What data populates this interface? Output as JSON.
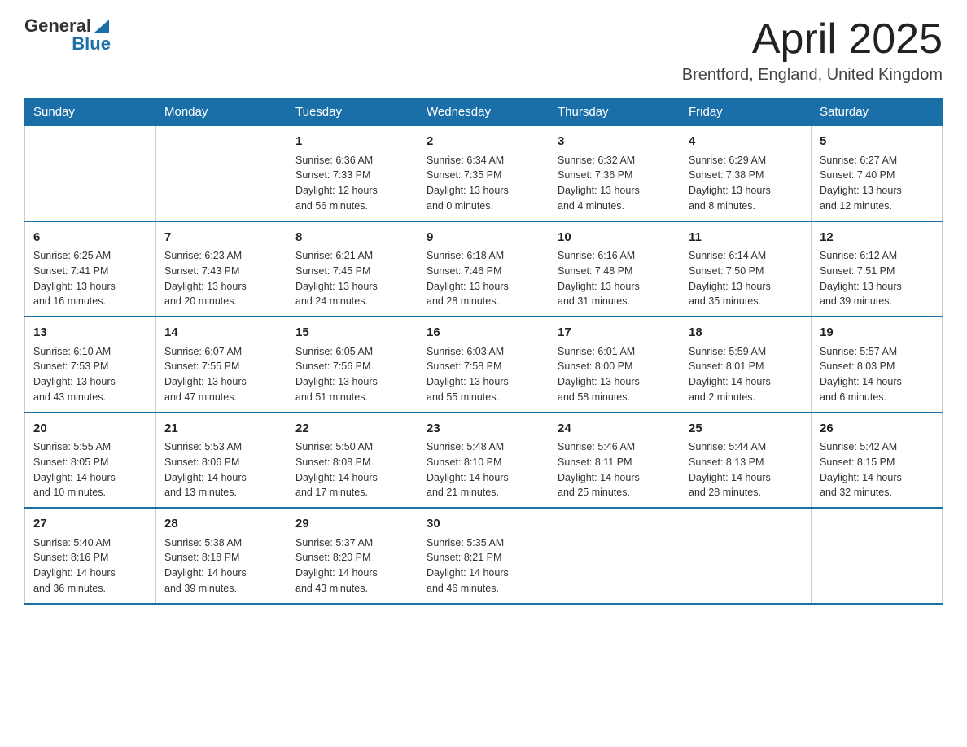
{
  "header": {
    "logo_general": "General",
    "logo_blue": "Blue",
    "title": "April 2025",
    "location": "Brentford, England, United Kingdom"
  },
  "calendar": {
    "days_of_week": [
      "Sunday",
      "Monday",
      "Tuesday",
      "Wednesday",
      "Thursday",
      "Friday",
      "Saturday"
    ],
    "weeks": [
      [
        {
          "day": "",
          "info": ""
        },
        {
          "day": "",
          "info": ""
        },
        {
          "day": "1",
          "info": "Sunrise: 6:36 AM\nSunset: 7:33 PM\nDaylight: 12 hours\nand 56 minutes."
        },
        {
          "day": "2",
          "info": "Sunrise: 6:34 AM\nSunset: 7:35 PM\nDaylight: 13 hours\nand 0 minutes."
        },
        {
          "day": "3",
          "info": "Sunrise: 6:32 AM\nSunset: 7:36 PM\nDaylight: 13 hours\nand 4 minutes."
        },
        {
          "day": "4",
          "info": "Sunrise: 6:29 AM\nSunset: 7:38 PM\nDaylight: 13 hours\nand 8 minutes."
        },
        {
          "day": "5",
          "info": "Sunrise: 6:27 AM\nSunset: 7:40 PM\nDaylight: 13 hours\nand 12 minutes."
        }
      ],
      [
        {
          "day": "6",
          "info": "Sunrise: 6:25 AM\nSunset: 7:41 PM\nDaylight: 13 hours\nand 16 minutes."
        },
        {
          "day": "7",
          "info": "Sunrise: 6:23 AM\nSunset: 7:43 PM\nDaylight: 13 hours\nand 20 minutes."
        },
        {
          "day": "8",
          "info": "Sunrise: 6:21 AM\nSunset: 7:45 PM\nDaylight: 13 hours\nand 24 minutes."
        },
        {
          "day": "9",
          "info": "Sunrise: 6:18 AM\nSunset: 7:46 PM\nDaylight: 13 hours\nand 28 minutes."
        },
        {
          "day": "10",
          "info": "Sunrise: 6:16 AM\nSunset: 7:48 PM\nDaylight: 13 hours\nand 31 minutes."
        },
        {
          "day": "11",
          "info": "Sunrise: 6:14 AM\nSunset: 7:50 PM\nDaylight: 13 hours\nand 35 minutes."
        },
        {
          "day": "12",
          "info": "Sunrise: 6:12 AM\nSunset: 7:51 PM\nDaylight: 13 hours\nand 39 minutes."
        }
      ],
      [
        {
          "day": "13",
          "info": "Sunrise: 6:10 AM\nSunset: 7:53 PM\nDaylight: 13 hours\nand 43 minutes."
        },
        {
          "day": "14",
          "info": "Sunrise: 6:07 AM\nSunset: 7:55 PM\nDaylight: 13 hours\nand 47 minutes."
        },
        {
          "day": "15",
          "info": "Sunrise: 6:05 AM\nSunset: 7:56 PM\nDaylight: 13 hours\nand 51 minutes."
        },
        {
          "day": "16",
          "info": "Sunrise: 6:03 AM\nSunset: 7:58 PM\nDaylight: 13 hours\nand 55 minutes."
        },
        {
          "day": "17",
          "info": "Sunrise: 6:01 AM\nSunset: 8:00 PM\nDaylight: 13 hours\nand 58 minutes."
        },
        {
          "day": "18",
          "info": "Sunrise: 5:59 AM\nSunset: 8:01 PM\nDaylight: 14 hours\nand 2 minutes."
        },
        {
          "day": "19",
          "info": "Sunrise: 5:57 AM\nSunset: 8:03 PM\nDaylight: 14 hours\nand 6 minutes."
        }
      ],
      [
        {
          "day": "20",
          "info": "Sunrise: 5:55 AM\nSunset: 8:05 PM\nDaylight: 14 hours\nand 10 minutes."
        },
        {
          "day": "21",
          "info": "Sunrise: 5:53 AM\nSunset: 8:06 PM\nDaylight: 14 hours\nand 13 minutes."
        },
        {
          "day": "22",
          "info": "Sunrise: 5:50 AM\nSunset: 8:08 PM\nDaylight: 14 hours\nand 17 minutes."
        },
        {
          "day": "23",
          "info": "Sunrise: 5:48 AM\nSunset: 8:10 PM\nDaylight: 14 hours\nand 21 minutes."
        },
        {
          "day": "24",
          "info": "Sunrise: 5:46 AM\nSunset: 8:11 PM\nDaylight: 14 hours\nand 25 minutes."
        },
        {
          "day": "25",
          "info": "Sunrise: 5:44 AM\nSunset: 8:13 PM\nDaylight: 14 hours\nand 28 minutes."
        },
        {
          "day": "26",
          "info": "Sunrise: 5:42 AM\nSunset: 8:15 PM\nDaylight: 14 hours\nand 32 minutes."
        }
      ],
      [
        {
          "day": "27",
          "info": "Sunrise: 5:40 AM\nSunset: 8:16 PM\nDaylight: 14 hours\nand 36 minutes."
        },
        {
          "day": "28",
          "info": "Sunrise: 5:38 AM\nSunset: 8:18 PM\nDaylight: 14 hours\nand 39 minutes."
        },
        {
          "day": "29",
          "info": "Sunrise: 5:37 AM\nSunset: 8:20 PM\nDaylight: 14 hours\nand 43 minutes."
        },
        {
          "day": "30",
          "info": "Sunrise: 5:35 AM\nSunset: 8:21 PM\nDaylight: 14 hours\nand 46 minutes."
        },
        {
          "day": "",
          "info": ""
        },
        {
          "day": "",
          "info": ""
        },
        {
          "day": "",
          "info": ""
        }
      ]
    ]
  }
}
